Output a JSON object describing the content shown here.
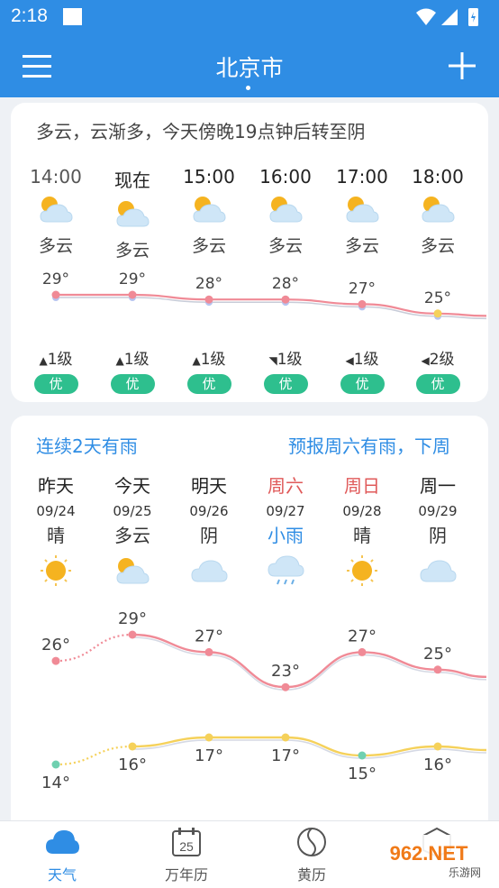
{
  "status": {
    "time": "2:18"
  },
  "header": {
    "city": "北京市"
  },
  "hourly": {
    "summary": "多云，云渐多，今天傍晚19点钟后转至阴",
    "items": [
      {
        "time": "14:00",
        "cond": "多云",
        "temp": "29°",
        "wind": "1级",
        "aqi": "优"
      },
      {
        "time": "现在",
        "cond": "多云",
        "temp": "29°",
        "wind": "1级",
        "aqi": "优"
      },
      {
        "time": "15:00",
        "cond": "多云",
        "temp": "28°",
        "wind": "1级",
        "aqi": "优"
      },
      {
        "time": "16:00",
        "cond": "多云",
        "temp": "28°",
        "wind": "1级",
        "aqi": "优"
      },
      {
        "time": "17:00",
        "cond": "多云",
        "temp": "27°",
        "wind": "1级",
        "aqi": "优"
      },
      {
        "time": "18:00",
        "cond": "多云",
        "temp": "25°",
        "wind": "2级",
        "aqi": "优"
      }
    ]
  },
  "daily": {
    "notice_left": "连续2天有雨",
    "notice_right": "预报周六有雨，下周",
    "items": [
      {
        "day": "昨天",
        "date": "09/24",
        "cond": "晴",
        "high": "26°",
        "low": "14°"
      },
      {
        "day": "今天",
        "date": "09/25",
        "cond": "多云",
        "high": "29°",
        "low": "16°"
      },
      {
        "day": "明天",
        "date": "09/26",
        "cond": "阴",
        "high": "27°",
        "low": "17°"
      },
      {
        "day": "周六",
        "date": "09/27",
        "cond": "小雨",
        "high": "23°",
        "low": "17°"
      },
      {
        "day": "周日",
        "date": "09/28",
        "cond": "晴",
        "high": "27°",
        "low": "15°"
      },
      {
        "day": "周一",
        "date": "09/29",
        "cond": "阴",
        "high": "25°",
        "low": "16°"
      }
    ]
  },
  "tabs": [
    {
      "label": "天气",
      "icon": "cloud-icon",
      "active": true
    },
    {
      "label": "万年历",
      "icon": "calendar-icon",
      "calendar_day": "25"
    },
    {
      "label": "黄历",
      "icon": "yin-yang-icon"
    },
    {
      "label": "",
      "icon": "box-icon"
    }
  ],
  "watermark": {
    "text": "962.NET",
    "sub": "乐游网"
  },
  "colors": {
    "primary": "#2f8de4",
    "aqi": "#2ebf8e",
    "weekend": "#e05a5a",
    "high_line": "#f08a96",
    "low_line": "#f5d15a"
  }
}
